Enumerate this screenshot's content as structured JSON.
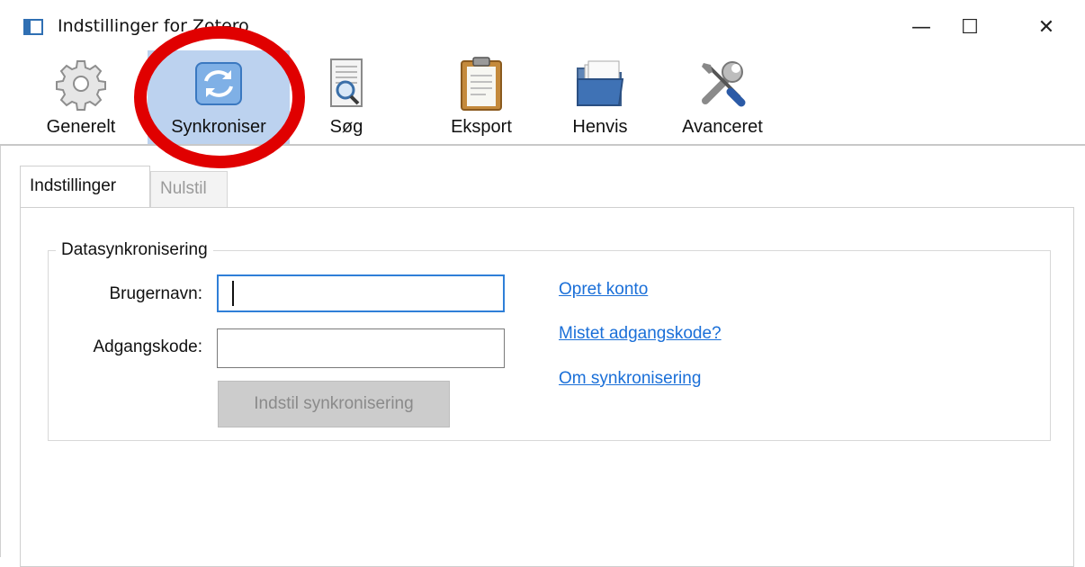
{
  "window": {
    "title": "Indstillinger for Zotero",
    "controls": {
      "minimize": "—",
      "maximize": "☐",
      "close": "✕"
    }
  },
  "toolbar": {
    "items": [
      {
        "label": "Generelt",
        "icon": "gear-icon",
        "selected": false
      },
      {
        "label": "Synkroniser",
        "icon": "sync-icon",
        "selected": true
      },
      {
        "label": "Søg",
        "icon": "search-document-icon",
        "selected": false
      },
      {
        "label": "Eksport",
        "icon": "clipboard-icon",
        "selected": false
      },
      {
        "label": "Henvis",
        "icon": "folder-icon",
        "selected": false
      },
      {
        "label": "Avanceret",
        "icon": "tools-icon",
        "selected": false
      }
    ]
  },
  "tabs": [
    {
      "label": "Indstillinger",
      "active": true
    },
    {
      "label": "Nulstil",
      "active": false
    }
  ],
  "sync_group": {
    "title": "Datasynkronisering",
    "username_label": "Brugernavn:",
    "username_value": "",
    "password_label": "Adgangskode:",
    "password_value": "",
    "setup_button": "Indstil synkronisering",
    "links": {
      "create_account": "Opret konto",
      "lost_password": "Mistet adgangskode?",
      "about_sync": "Om synkronisering"
    }
  },
  "colors": {
    "selected_tool_bg": "#bcd2ef",
    "link": "#1a6fd8",
    "focus_border": "#2f7fd8",
    "annotation": "#e00000"
  }
}
